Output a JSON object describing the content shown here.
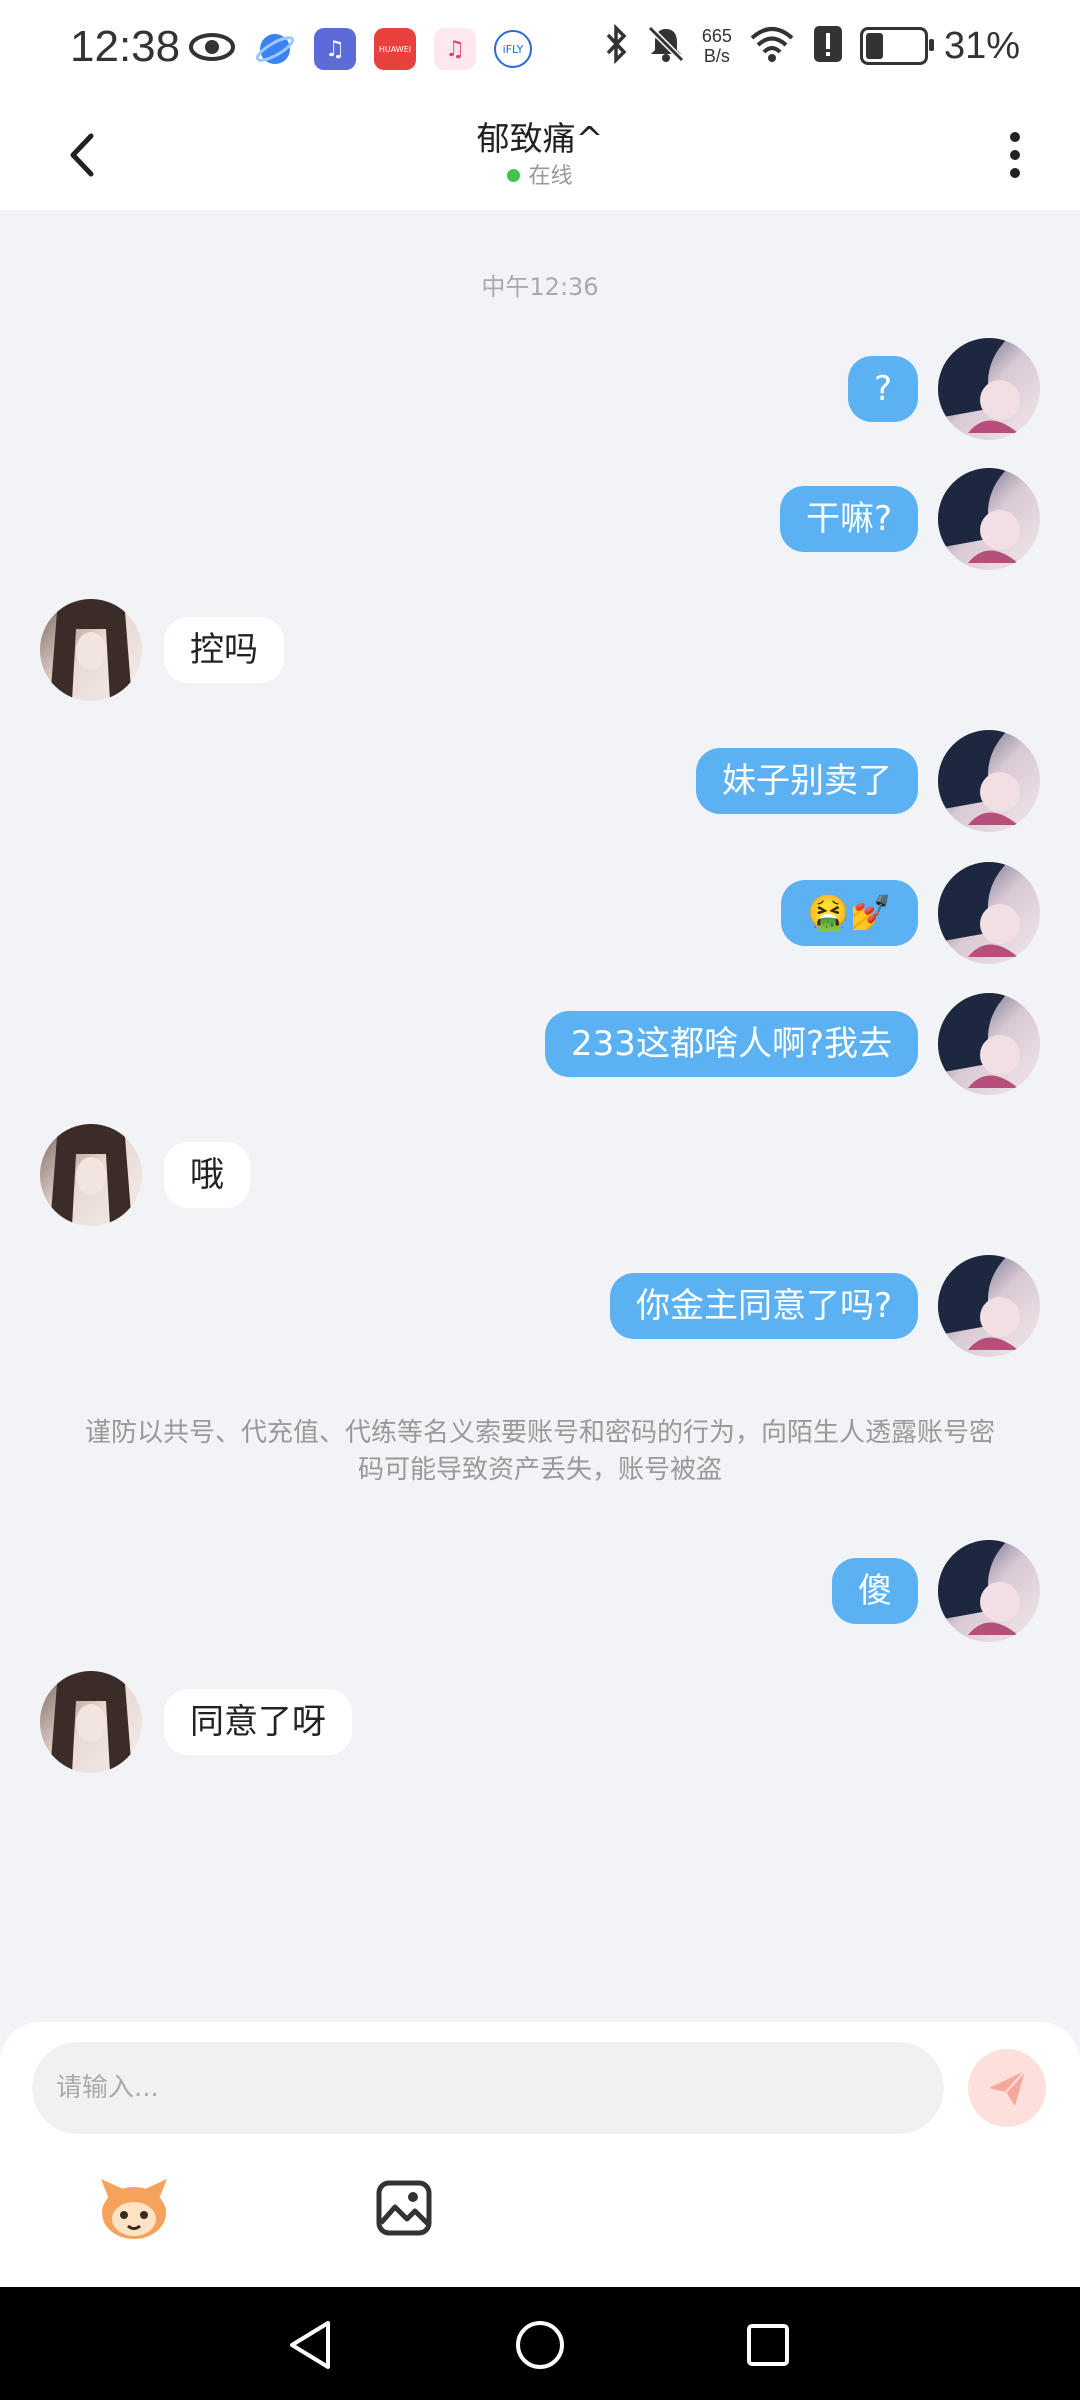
{
  "status_bar": {
    "time": "12:38",
    "net_speed_value": "665",
    "net_speed_unit": "B/s",
    "battery": "31%",
    "battery_level": 0.31,
    "app_icons": [
      "eye-icon",
      "browser-icon",
      "music-app-icon",
      "huawei-appgallery-icon",
      "music-icon",
      "ifly-icon"
    ],
    "huawei_label": "HUAWEI",
    "ifly_label": "iFLY",
    "system_icons": [
      "bluetooth-icon",
      "mute-icon",
      "wifi-icon",
      "alert-icon",
      "battery-icon"
    ]
  },
  "header": {
    "title": "郁致痛^",
    "status": "在线",
    "status_color": "#3fc64a"
  },
  "chat": {
    "time_label": "中午12:36",
    "messages": [
      {
        "dir": "out",
        "text": "?"
      },
      {
        "dir": "out",
        "text": "干嘛?"
      },
      {
        "dir": "in",
        "text": "控吗"
      },
      {
        "dir": "out",
        "text": "妹子别卖了"
      },
      {
        "dir": "out",
        "text": "🤮💅"
      },
      {
        "dir": "out",
        "text": "233这都啥人啊?我去"
      },
      {
        "dir": "in",
        "text": "哦"
      },
      {
        "dir": "out",
        "text": "你金主同意了吗?"
      },
      {
        "dir": "out",
        "text": "傻"
      },
      {
        "dir": "in",
        "text": "同意了呀"
      }
    ],
    "notice": "谨防以共号、代充值、代练等名义索要账号和密码的行为，向陌生人透露账号密码可能导致资产丢失，账号被盗"
  },
  "composer": {
    "placeholder": "请输入...",
    "value": ""
  },
  "colors": {
    "bubble_out": "#5bb1f2",
    "bubble_in": "#ffffff",
    "background": "#f1f3f6",
    "send_button": "#fde0dc",
    "send_icon": "#f7a89c"
  }
}
